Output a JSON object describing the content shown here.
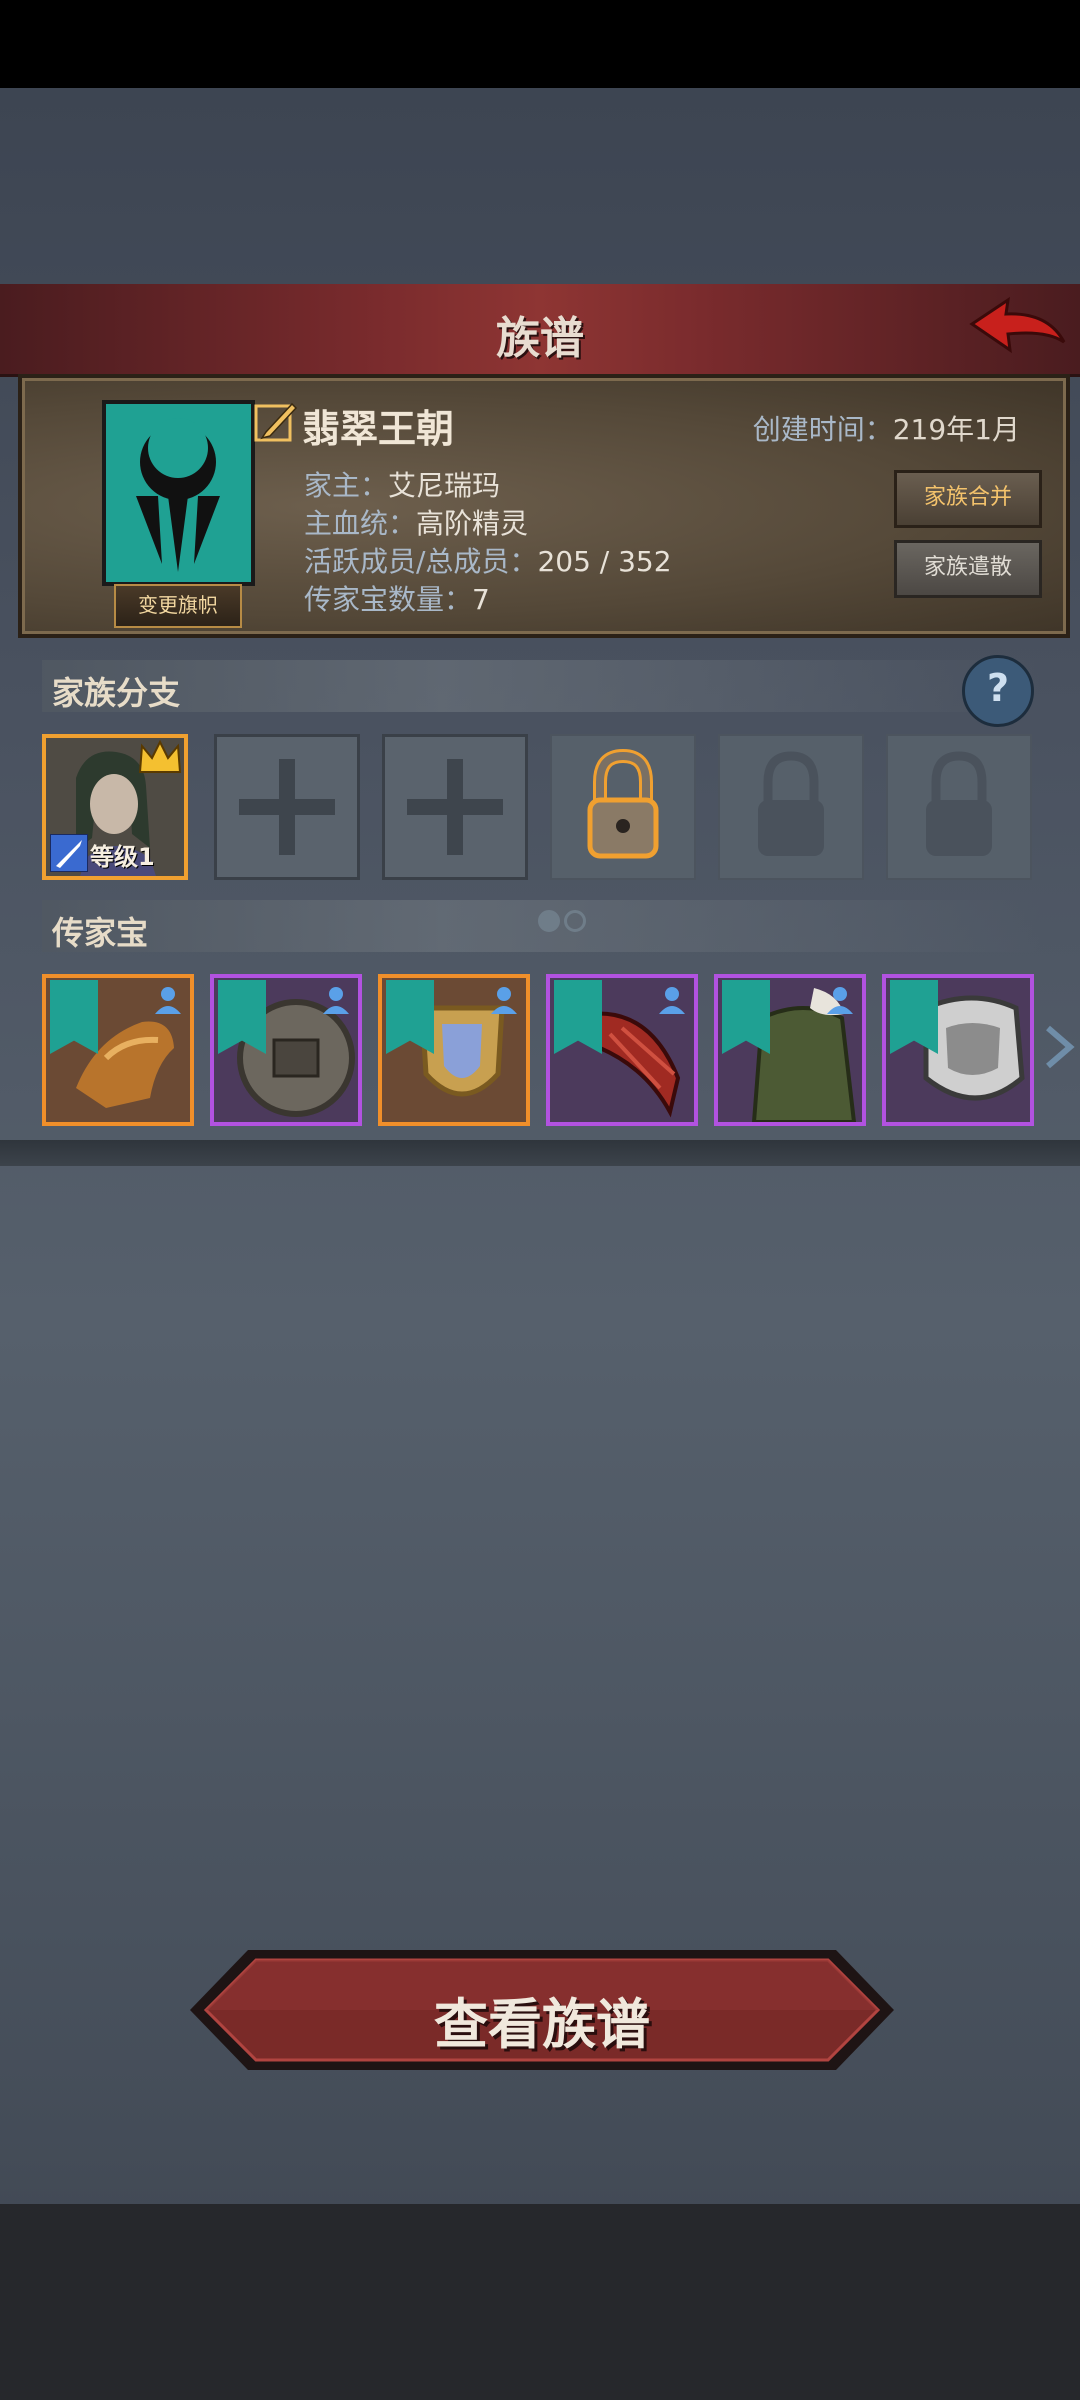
{
  "header": {
    "title": "族谱"
  },
  "family": {
    "name": "翡翠王朝",
    "created_label": "创建时间：",
    "created_value": "219年1月",
    "head_label": "家主：",
    "head_value": "艾尼瑞玛",
    "bloodline_label": "主血统：",
    "bloodline_value": "高阶精灵",
    "members_label": "活跃成员/总成员：",
    "members_value": "205 / 352",
    "heirloom_label": "传家宝数量：",
    "heirloom_value": "7",
    "change_banner_label": "变更旗帜",
    "merge_label": "家族合并",
    "disband_label": "家族遣散",
    "banner_color": "#1fa193"
  },
  "branches": {
    "title": "家族分支",
    "member": {
      "level_label": "等级1"
    },
    "slots": [
      {
        "state": "empty"
      },
      {
        "state": "empty"
      },
      {
        "state": "lock-next"
      },
      {
        "state": "locked"
      },
      {
        "state": "locked"
      }
    ]
  },
  "heirlooms": {
    "title": "传家宝",
    "page_count": 2,
    "current_page": 1,
    "items": [
      {
        "rarity": "orange",
        "icon": "dragon-gauntlet-icon"
      },
      {
        "rarity": "purple",
        "icon": "round-shield-icon"
      },
      {
        "rarity": "orange",
        "icon": "gold-shield-icon"
      },
      {
        "rarity": "purple",
        "icon": "red-claw-icon"
      },
      {
        "rarity": "purple",
        "icon": "green-cloak-icon"
      },
      {
        "rarity": "purple",
        "icon": "plate-armor-icon"
      }
    ]
  },
  "main_button": {
    "label": "查看族谱"
  }
}
